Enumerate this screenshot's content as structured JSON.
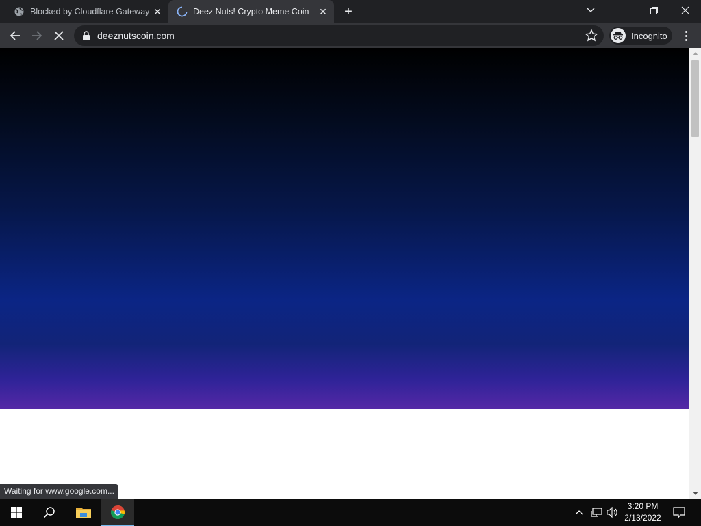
{
  "browser": {
    "tabs": [
      {
        "title": "Blocked by Cloudflare Gateway",
        "active": false
      },
      {
        "title": "Deez Nuts! Crypto Meme Coin",
        "active": true
      }
    ],
    "address": "deeznutscoin.com",
    "incognito_label": "Incognito",
    "status_text": "Waiting for www.google.com..."
  },
  "page": {
    "hero_gradient": [
      "#000000",
      "#06174a",
      "#0b2585",
      "#5528a6"
    ]
  },
  "taskbar": {
    "time": "3:20 PM",
    "date": "2/13/2022",
    "accent": "#76b9ed"
  }
}
